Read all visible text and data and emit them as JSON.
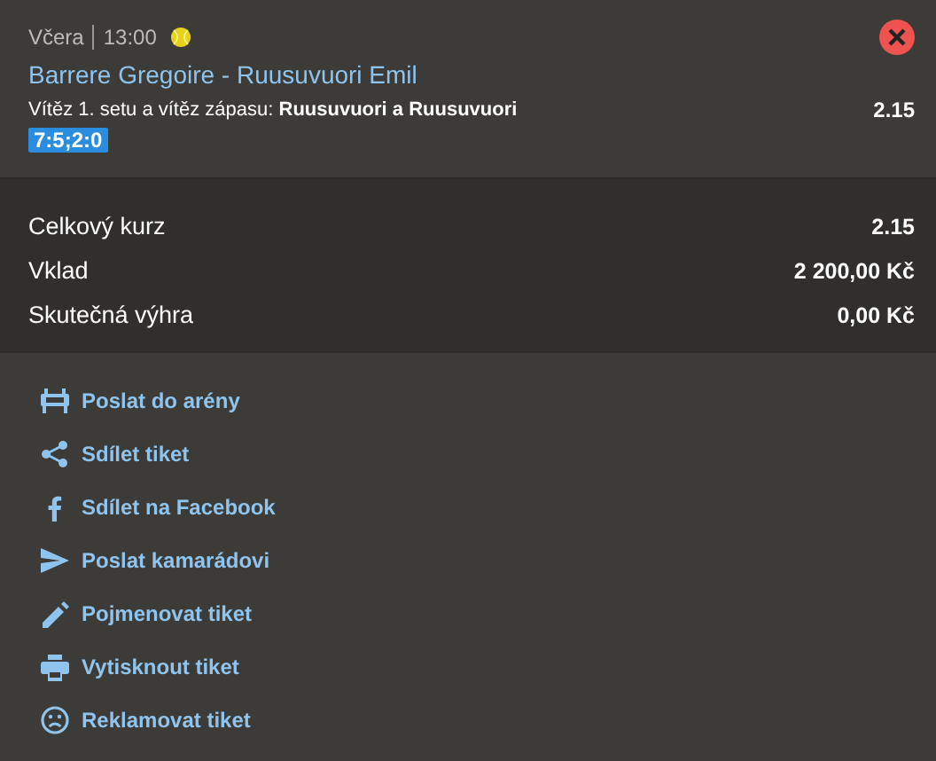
{
  "header": {
    "day": "Včera",
    "time": "13:00",
    "match": "Barrere Gregoire - Ruusuvuori Emil",
    "bet_label": "Vítěz 1. setu a vítěz zápasu:",
    "bet_pick": "Ruusuvuori a Ruusuvuori",
    "odds": "2.15",
    "score": "7:5;2:0"
  },
  "summary": [
    {
      "label": "Celkový kurz",
      "value": "2.15"
    },
    {
      "label": "Vklad",
      "value": "2 200,00 Kč"
    },
    {
      "label": "Skutečná výhra",
      "value": "0,00 Kč"
    }
  ],
  "actions": [
    {
      "kind": "arena",
      "label": "Poslat do arény"
    },
    {
      "kind": "share",
      "label": "Sdílet tiket"
    },
    {
      "kind": "facebook",
      "label": "Sdílet na Facebook"
    },
    {
      "kind": "send",
      "label": "Poslat kamarádovi"
    },
    {
      "kind": "rename",
      "label": "Pojmenovat tiket"
    },
    {
      "kind": "print",
      "label": "Vytisknout tiket"
    },
    {
      "kind": "complain",
      "label": "Reklamovat tiket"
    }
  ]
}
